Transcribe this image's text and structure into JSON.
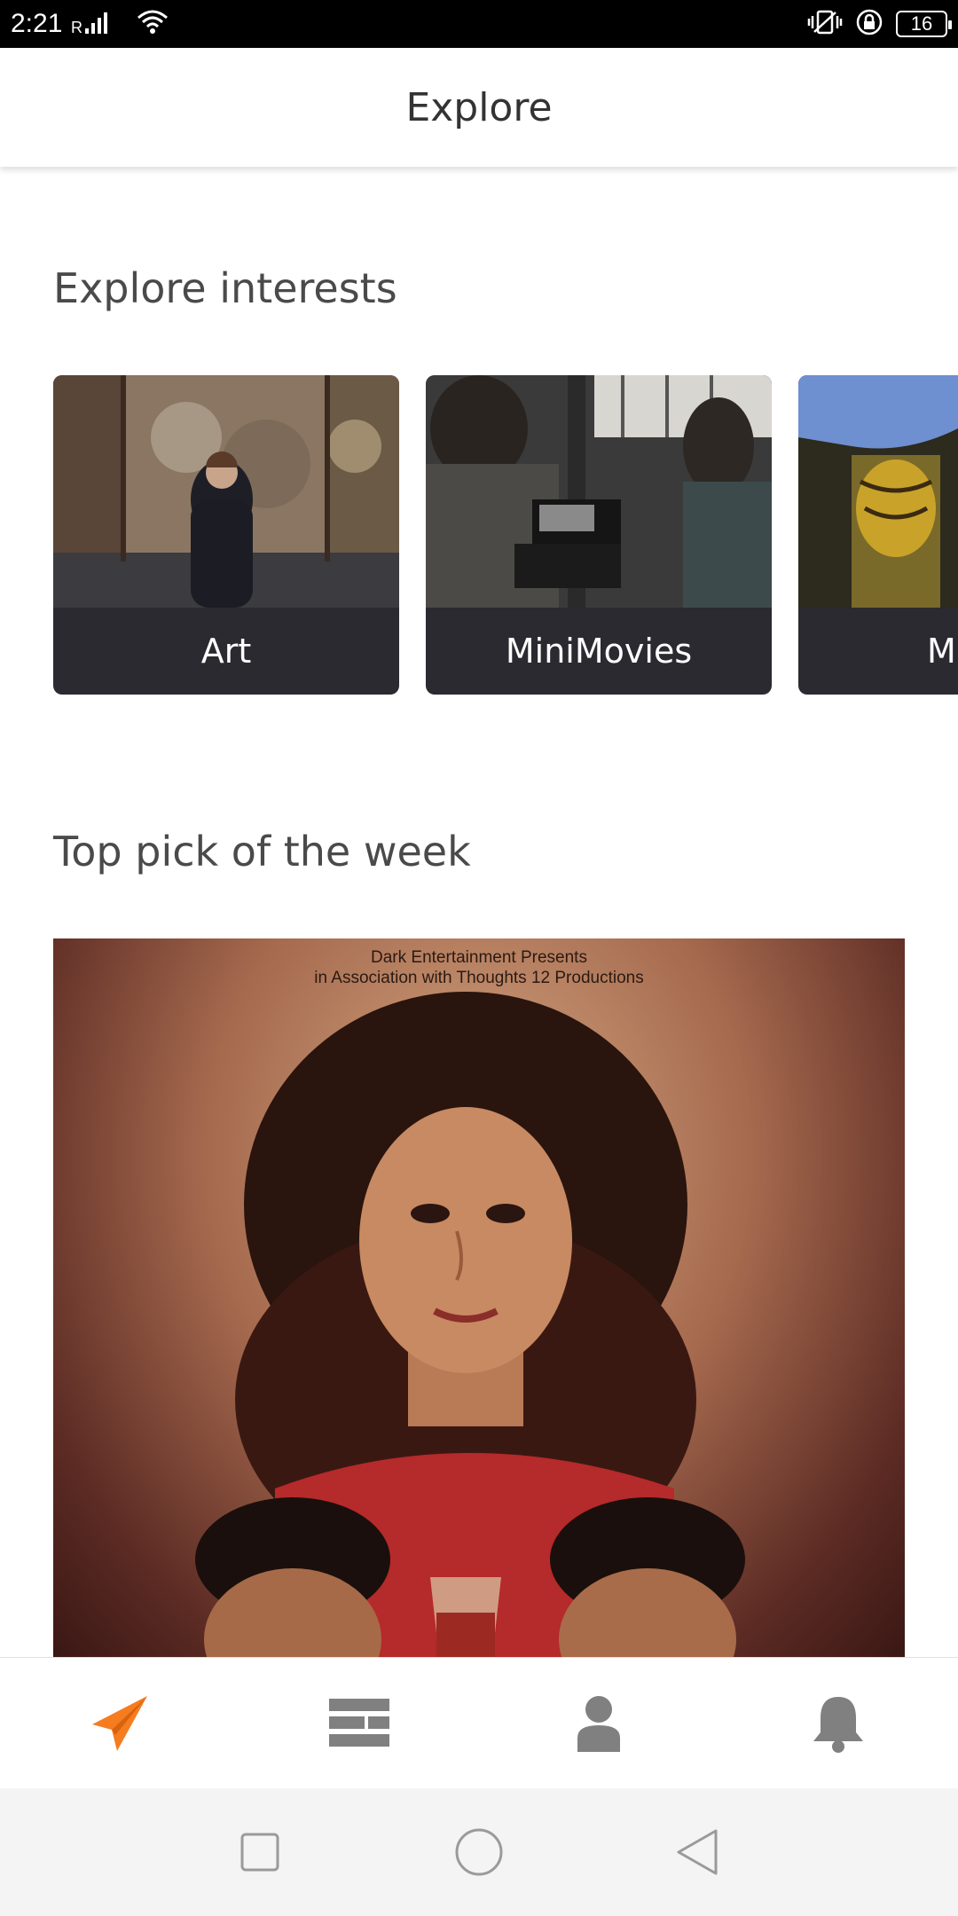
{
  "status_bar": {
    "time": "2:21",
    "network": "R",
    "battery": "16"
  },
  "header": {
    "title": "Explore"
  },
  "interests": {
    "title": "Explore interests",
    "cards": [
      {
        "label": "Art"
      },
      {
        "label": "MiniMovies"
      },
      {
        "label": "M"
      }
    ]
  },
  "top_pick": {
    "title": "Top pick of the week",
    "poster_credit_line1": "Dark Entertainment Presents",
    "poster_credit_line2": "in Association with Thoughts 12 Productions"
  },
  "bottom_nav": {
    "items": [
      {
        "icon": "send-icon",
        "active": true
      },
      {
        "icon": "feed-icon",
        "active": false
      },
      {
        "icon": "profile-icon",
        "active": false
      },
      {
        "icon": "bell-icon",
        "active": false
      }
    ]
  },
  "colors": {
    "accent": "#f57c1f",
    "icon_inactive": "#808080",
    "card_bg": "#2b2a30"
  }
}
